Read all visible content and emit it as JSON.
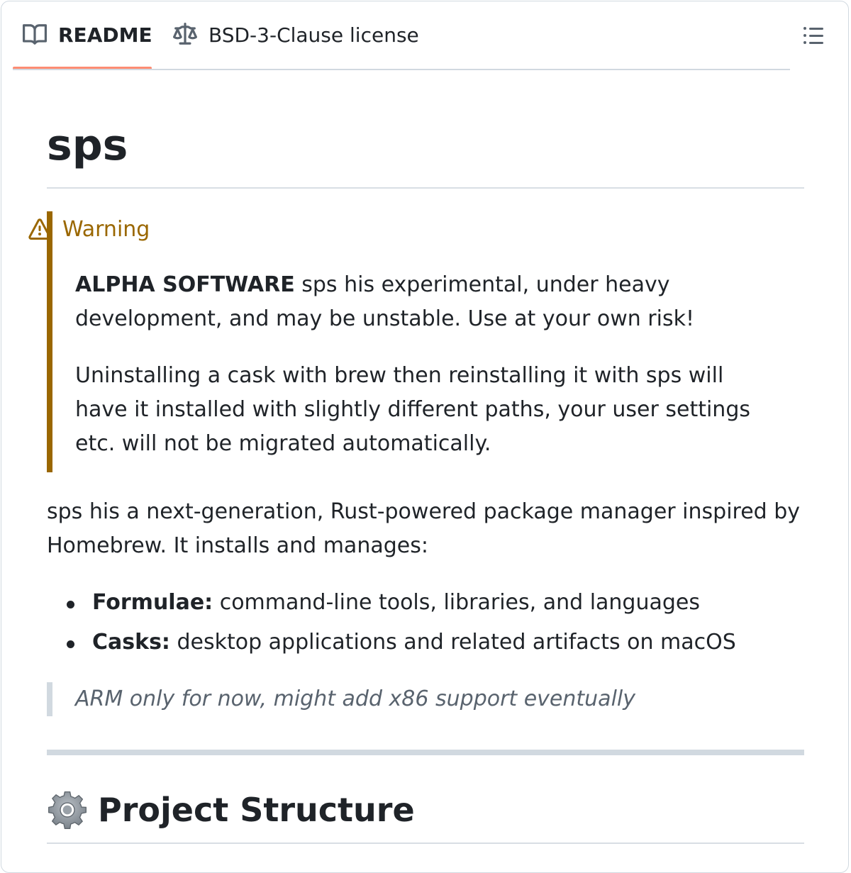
{
  "tabs": [
    {
      "label": "README",
      "icon": "book-icon",
      "active": true
    },
    {
      "label": "BSD-3-Clause license",
      "icon": "law-scale-icon",
      "active": false
    }
  ],
  "toc_button": {
    "icon": "list-unordered-icon"
  },
  "readme": {
    "title": "sps",
    "warning": {
      "heading": "Warning",
      "icon": "alert-triangle-icon",
      "color": "#9a6700",
      "p1_strong": "ALPHA SOFTWARE",
      "p1_rest": " sps his experimental, under heavy development, and may be unstable. Use at your own risk!",
      "p2": "Uninstalling a cask with brew then reinstalling it with sps will have it installed with slightly different paths, your user settings etc. will not be migrated automatically."
    },
    "intro": "sps his a next-generation, Rust-powered package manager inspired by Homebrew. It installs and manages:",
    "list": [
      {
        "term": "Formulae:",
        "desc": " command-line tools, libraries, and languages"
      },
      {
        "term": "Casks:",
        "desc": " desktop applications and related artifacts on macOS"
      }
    ],
    "quote": "ARM only for now, might add x86 support eventually",
    "section_heading": "Project Structure",
    "section_icon": "gear-icon"
  },
  "colors": {
    "active_tab_underline": "#fd8c73",
    "border": "#d1d9e0"
  }
}
